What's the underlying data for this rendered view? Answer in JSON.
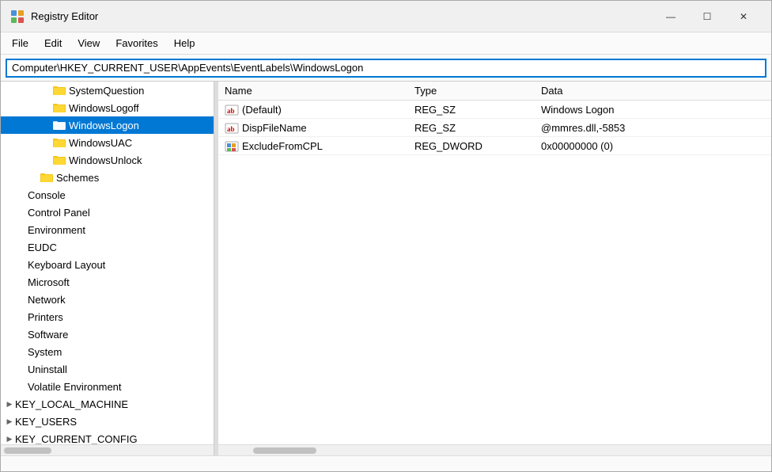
{
  "window": {
    "title": "Registry Editor",
    "icon": "registry-icon"
  },
  "controls": {
    "minimize": "—",
    "maximize": "☐",
    "close": "✕"
  },
  "menu": {
    "items": [
      "File",
      "Edit",
      "View",
      "Favorites",
      "Help"
    ]
  },
  "address_bar": {
    "value": "Computer\\HKEY_CURRENT_USER\\AppEvents\\EventLabels\\WindowsLogon"
  },
  "tree": {
    "items": [
      {
        "id": "systemquestion",
        "label": "SystemQuestion",
        "level": 2,
        "indent": 3,
        "expanded": false
      },
      {
        "id": "windowslogoff",
        "label": "WindowsLogoff",
        "level": 2,
        "indent": 3,
        "expanded": false
      },
      {
        "id": "windowslogon",
        "label": "WindowsLogon",
        "level": 2,
        "indent": 3,
        "expanded": false,
        "selected": true
      },
      {
        "id": "windowsuac",
        "label": "WindowsUAC",
        "level": 2,
        "indent": 3,
        "expanded": false
      },
      {
        "id": "windowsunlock",
        "label": "WindowsUnlock",
        "level": 2,
        "indent": 3,
        "expanded": false
      },
      {
        "id": "schemes",
        "label": "Schemes",
        "level": 1,
        "indent": 2,
        "expanded": false
      },
      {
        "id": "console",
        "label": "Console",
        "level": 0,
        "indent": 1,
        "expanded": false
      },
      {
        "id": "controlpanel",
        "label": "Control Panel",
        "level": 0,
        "indent": 1,
        "expanded": false
      },
      {
        "id": "environment",
        "label": "Environment",
        "level": 0,
        "indent": 1,
        "expanded": false
      },
      {
        "id": "eudc",
        "label": "EUDC",
        "level": 0,
        "indent": 1,
        "expanded": false
      },
      {
        "id": "keyboardlayout",
        "label": "Keyboard Layout",
        "level": 0,
        "indent": 1,
        "expanded": false
      },
      {
        "id": "microsoft",
        "label": "Microsoft",
        "level": 0,
        "indent": 1,
        "expanded": false
      },
      {
        "id": "network",
        "label": "Network",
        "level": 0,
        "indent": 1,
        "expanded": false
      },
      {
        "id": "printers",
        "label": "Printers",
        "level": 0,
        "indent": 1,
        "expanded": false
      },
      {
        "id": "software",
        "label": "Software",
        "level": 0,
        "indent": 1,
        "expanded": false
      },
      {
        "id": "system",
        "label": "System",
        "level": 0,
        "indent": 1,
        "expanded": false
      },
      {
        "id": "uninstall",
        "label": "Uninstall",
        "level": 0,
        "indent": 1,
        "expanded": false
      },
      {
        "id": "volatileenv",
        "label": "Volatile Environment",
        "level": 0,
        "indent": 1,
        "expanded": false
      },
      {
        "id": "keylocalmachine",
        "label": "KEY_LOCAL_MACHINE",
        "level": -1,
        "indent": 0,
        "expanded": false
      },
      {
        "id": "keyusers",
        "label": "KEY_USERS",
        "level": -1,
        "indent": 0,
        "expanded": false
      },
      {
        "id": "keycurrentconfig",
        "label": "KEY_CURRENT_CONFIG",
        "level": -1,
        "indent": 0,
        "expanded": false
      }
    ]
  },
  "registry_table": {
    "columns": [
      "Name",
      "Type",
      "Data"
    ],
    "rows": [
      {
        "name": "(Default)",
        "type": "REG_SZ",
        "data": "Windows Logon",
        "icon": "ab"
      },
      {
        "name": "DispFileName",
        "type": "REG_SZ",
        "data": "@mmres.dll,-5853",
        "icon": "ab"
      },
      {
        "name": "ExcludeFromCPL",
        "type": "REG_DWORD",
        "data": "0x00000000 (0)",
        "icon": "dword"
      }
    ]
  }
}
